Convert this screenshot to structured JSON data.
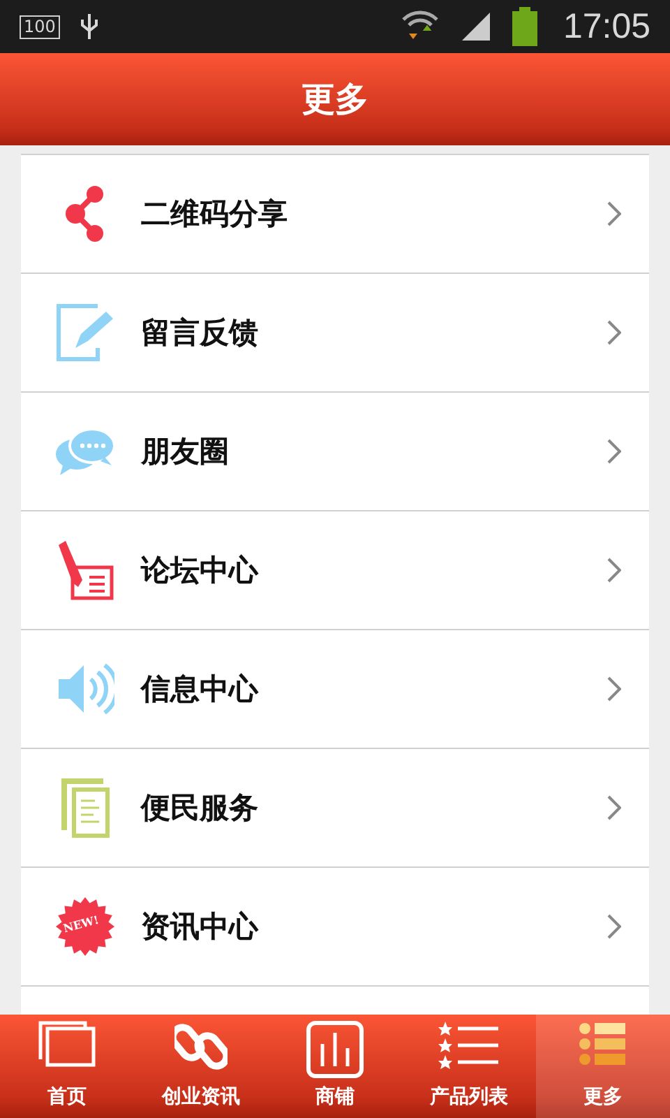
{
  "status_bar": {
    "battery_label": "100",
    "time": "17:05"
  },
  "header": {
    "title": "更多"
  },
  "menu": [
    {
      "label": "二维码分享"
    },
    {
      "label": "留言反馈"
    },
    {
      "label": "朋友圈"
    },
    {
      "label": "论坛中心"
    },
    {
      "label": "信息中心"
    },
    {
      "label": "便民服务"
    },
    {
      "label": "资讯中心",
      "badge": "NEW!"
    }
  ],
  "tabs": [
    {
      "label": "首页",
      "selected": false
    },
    {
      "label": "创业资讯",
      "selected": false
    },
    {
      "label": "商铺",
      "selected": false
    },
    {
      "label": "产品列表",
      "selected": false
    },
    {
      "label": "更多",
      "selected": true
    }
  ]
}
